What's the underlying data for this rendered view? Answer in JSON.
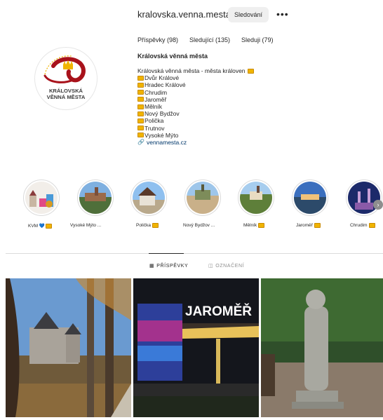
{
  "profile": {
    "username": "kralovska.venna.mesta",
    "follow_label": "Sledování",
    "more_label": "•••",
    "stats": {
      "posts": "Příspěvky (98)",
      "followers": "Sledující (135)",
      "following": "Sleduji (79)"
    },
    "bio_name": "Královská věnná města",
    "bio_intro": "Královská věnná města - města královen",
    "bio_cities": [
      "Dvůr Králové",
      "Hradec Králové",
      "Chrudim",
      "Jaroměř",
      "Mělník",
      "Nový Bydžov",
      "Polička",
      "Trutnov",
      "Vysoké Mýto"
    ],
    "website": "vennamesta.cz",
    "logo_line1": "KRÁLOVSKÁ",
    "logo_line2": "VĚNNÁ MĚSTA"
  },
  "highlights": [
    {
      "label": "KVM 💙",
      "crown": true
    },
    {
      "label": "Vysoké Mýto ...",
      "crown": false
    },
    {
      "label": "Polička",
      "crown": true
    },
    {
      "label": "Nový Bydžov ...",
      "crown": false
    },
    {
      "label": "Mělník",
      "crown": true
    },
    {
      "label": "Jaroměř",
      "crown": true
    },
    {
      "label": "Chrudim",
      "crown": true
    }
  ],
  "tabs": {
    "posts": "PŘÍSPĚVKY",
    "tagged": "OZNAČENÍ"
  },
  "posts": [
    {
      "subject": "castle tower in autumn park"
    },
    {
      "subject": "Jaroměř illuminated building at night",
      "sign_text": "JAROMĚŘ"
    },
    {
      "subject": "stone statue in park"
    }
  ],
  "icons": {
    "link": "link-icon",
    "grid": "grid-icon",
    "tag": "tag-icon",
    "next": "chevron-right-icon"
  },
  "colors": {
    "button_bg": "#efefef",
    "link": "#00376b",
    "crown": "#f0b400"
  }
}
